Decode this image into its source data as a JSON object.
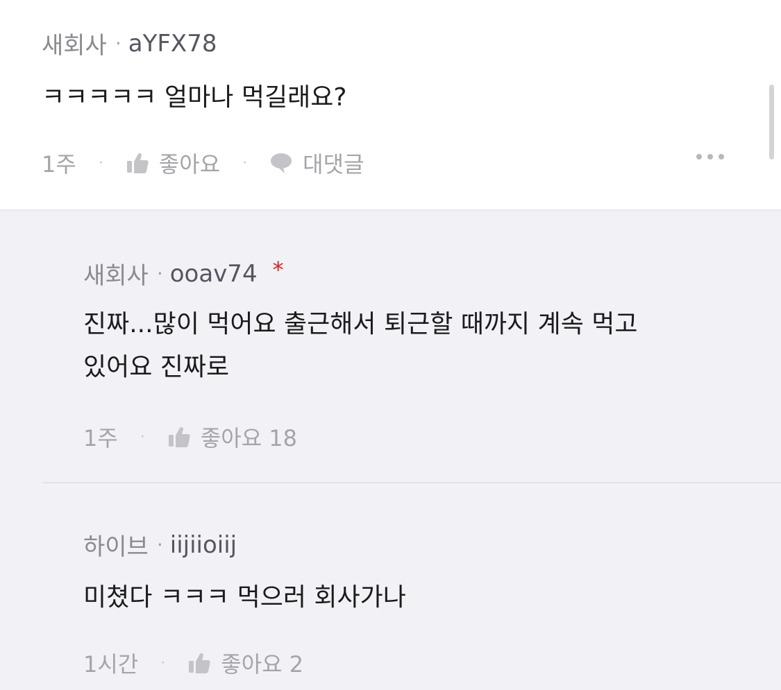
{
  "top_comment": {
    "company": "새회사",
    "nickname": "aYFX78",
    "text": "ㅋㅋㅋㅋㅋ 얼마나 먹길래요?",
    "time": "1주",
    "like_label": "좋아요",
    "reply_label": "대댓글"
  },
  "replies": [
    {
      "company": "새회사",
      "nickname": "ooav74",
      "author_marker": "*",
      "text_line1": "진짜...많이 먹어요 출근해서 퇴근할 때까지 계속 먹고",
      "text_line2": "있어요 진짜로",
      "time": "1주",
      "like_label": "좋아요 18"
    },
    {
      "company": "하이브",
      "nickname": "iijiioiij",
      "text": "미쳤다 ㅋㅋㅋ 먹으러 회사가나",
      "time": "1시간",
      "like_label": "좋아요 2"
    }
  ],
  "separator": "·",
  "icons": {
    "like": "thumbs-up-icon",
    "reply": "speech-bubble-icon",
    "more": "more-dots-icon"
  },
  "colors": {
    "background": "#ffffff",
    "reply_background": "#f2f2f6",
    "author_marker": "#e02020",
    "muted_text": "#a4a4a9"
  }
}
